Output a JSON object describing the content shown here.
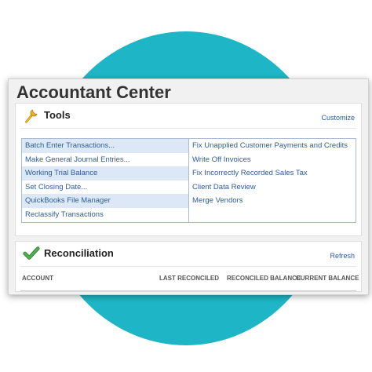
{
  "window": {
    "title": "Accountant Center"
  },
  "tools": {
    "title": "Tools",
    "customize_label": "Customize",
    "left_items": [
      "Batch Enter Transactions...",
      "Make General Journal Entries...",
      "Working Trial Balance",
      "Set Closing Date...",
      "QuickBooks File Manager",
      "Reclassify Transactions"
    ],
    "right_items": [
      "Fix Unapplied Customer Payments and Credits",
      "Write Off Invoices",
      "Fix Incorrectly Recorded Sales Tax",
      "Client Data Review",
      "Merge Vendors"
    ]
  },
  "reconciliation": {
    "title": "Reconciliation",
    "refresh_label": "Refresh",
    "columns": [
      "ACCOUNT",
      "LAST RECONCILED",
      "RECONCILED BALANCE",
      "CURRENT BALANCE"
    ]
  },
  "colors": {
    "accent_circle": "#1eb6c6",
    "link": "#2d5d9c",
    "row_highlight": "#dce8f5",
    "checkmark": "#3c9a3c",
    "wrench": "#d8a21c"
  },
  "icons": {
    "tools": "wrench-icon",
    "reconciliation": "checkmark-icon"
  }
}
